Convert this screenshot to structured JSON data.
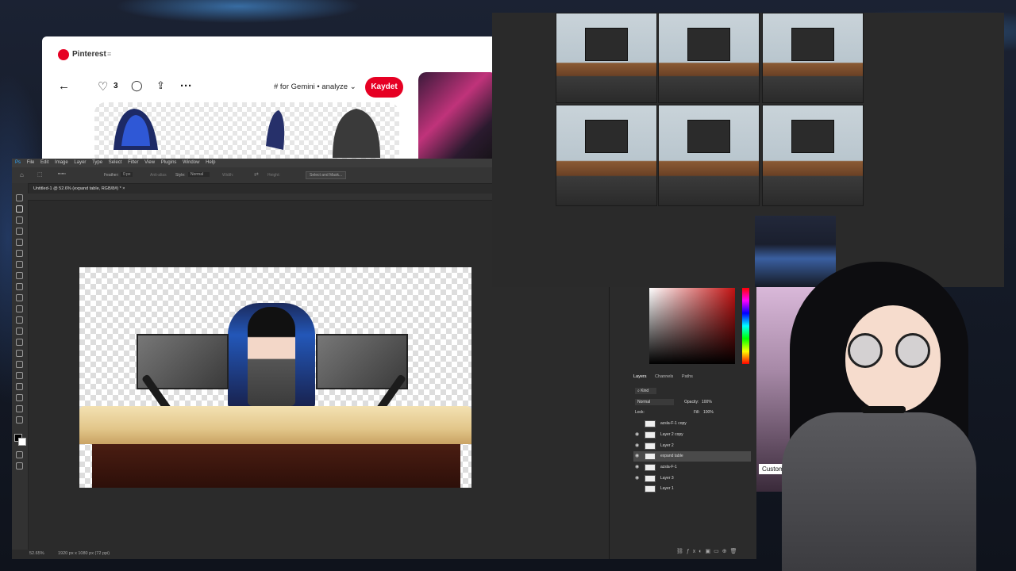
{
  "pinterest": {
    "brand": "Pinterest",
    "like_count": "3",
    "board_label": "# for Gemini • analyze",
    "save_label": "Kaydet"
  },
  "photoshop": {
    "menu": [
      "File",
      "Edit",
      "Image",
      "Layer",
      "Type",
      "Select",
      "Filter",
      "View",
      "Plugins",
      "Window",
      "Help"
    ],
    "options": {
      "feather_label": "Feather:",
      "feather_value": "0 px",
      "antialias_label": "Anti-alias",
      "style_label": "Style:",
      "style_value": "Normal",
      "width_label": "Width:",
      "height_label": "Height:",
      "select_mask": "Select and Mask..."
    },
    "doc_tab": "Untitled-1 @ 52.6% (expand table, RGB/8#) *",
    "zoom": "52.65%",
    "doc_size": "1920 px x 1080 px (72 ppi)"
  },
  "layers_panel": {
    "tabs": [
      "Layers",
      "Channels",
      "Paths"
    ],
    "kind_label": "Kind",
    "blend_mode": "Normal",
    "opacity_label": "Opacity:",
    "opacity_value": "100%",
    "lock_label": "Lock:",
    "fill_label": "Fill:",
    "fill_value": "100%",
    "layers": [
      {
        "name": "azsla-F-1 copy",
        "visible": false
      },
      {
        "name": "Layer 2 copy",
        "visible": true
      },
      {
        "name": "Layer 2",
        "visible": true
      },
      {
        "name": "expand table",
        "visible": true,
        "selected": true
      },
      {
        "name": "azsla-F-1",
        "visible": true
      },
      {
        "name": "Layer 3",
        "visible": true
      },
      {
        "name": "Layer 1",
        "visible": false
      }
    ]
  },
  "stream": {
    "caption": "Custom Sk"
  },
  "colors": {
    "pinterest_red": "#e60023",
    "ps_bg": "#2b2b2b",
    "color_picker_hue": "#c21212"
  }
}
